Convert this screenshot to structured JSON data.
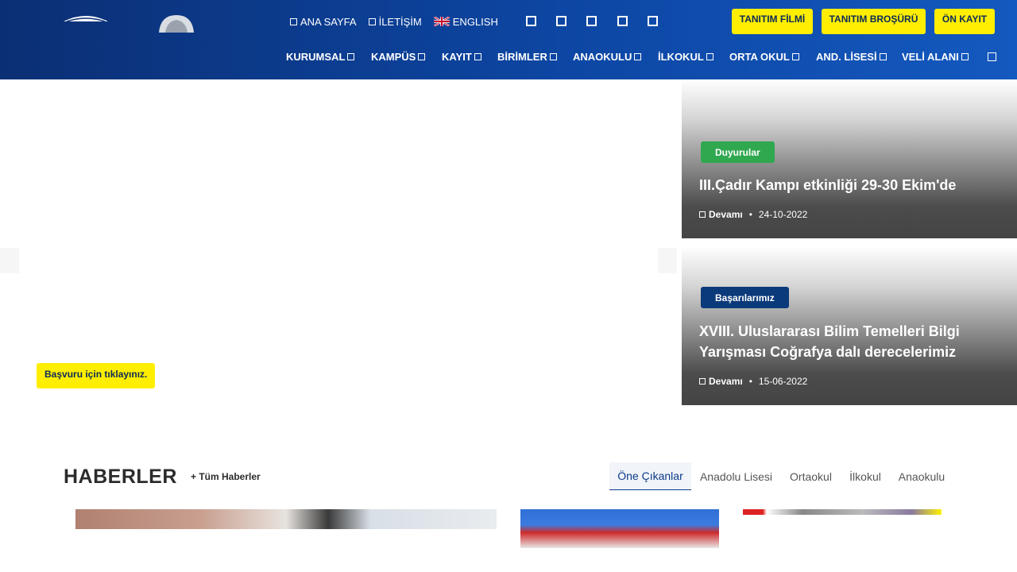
{
  "header": {
    "top_links": [
      {
        "label": "ANA SAYFA",
        "icon": "home-icon"
      },
      {
        "label": "İLETİŞİM",
        "icon": "envelope-icon"
      },
      {
        "label": "ENGLISH",
        "icon": "uk-flag-icon"
      }
    ],
    "social_icons": [
      "facebook-icon",
      "twitter-icon",
      "instagram-icon",
      "youtube-icon",
      "linkedin-icon"
    ],
    "cta_buttons": [
      "TANITIM FİLMİ",
      "TANITIM BROŞÜRÜ",
      "ÖN KAYIT"
    ],
    "cta_color": "#ffee00",
    "nav": [
      "KURUMSAL",
      "KAMPÜS",
      "KAYIT",
      "BİRİMLER",
      "ANAOKULU",
      "İLKOKUL",
      "ORTA OKUL",
      "AND. LİSESİ",
      "VELİ ALANI"
    ],
    "brand_color": "#0d46a3"
  },
  "slider": {
    "apply_button": "Başvuru için tıklayınız."
  },
  "featured": [
    {
      "category": "Duyurular",
      "category_color": "#2fa84f",
      "title": "III.Çadır Kampı etkinliği 29-30 Ekim'de",
      "more": "Devamı",
      "date": "24-10-2022"
    },
    {
      "category": "Başarılarımız",
      "category_color": "#0b3a7a",
      "title": "XVIII. Uluslararası Bilim Temelleri Bilgi Yarışması Coğrafya dalı derecelerimiz",
      "more": "Devamı",
      "date": "15-06-2022"
    }
  ],
  "news": {
    "title": "HABERLER",
    "all_link": "+ Tüm Haberler",
    "tabs": [
      "Öne Çıkanlar",
      "Anadolu Lisesi",
      "Ortaokul",
      "İlkokul",
      "Anaokulu"
    ],
    "active_tab": "Öne Çıkanlar"
  }
}
